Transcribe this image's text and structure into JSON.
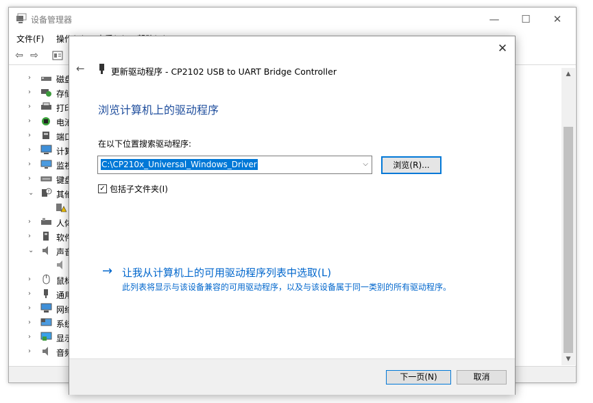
{
  "device_manager": {
    "title": "设备管理器",
    "window_controls": {
      "minimize": "—",
      "maximize": "☐",
      "close": "✕"
    },
    "menu": [
      "文件(F)",
      "操作(A)",
      "查看(V)",
      "帮助(H)"
    ],
    "toolbar_icons": [
      "back-arrow-icon",
      "forward-arrow-icon",
      "properties-icon"
    ],
    "tree": [
      {
        "chevron": "›",
        "label": "磁盘",
        "icon": "disk-drive-icon"
      },
      {
        "chevron": "›",
        "label": "存储",
        "icon": "storage-controller-icon"
      },
      {
        "chevron": "›",
        "label": "打印",
        "icon": "print-queue-icon"
      },
      {
        "chevron": "›",
        "label": "电池",
        "icon": "battery-icon"
      },
      {
        "chevron": "›",
        "label": "端口",
        "icon": "port-icon"
      },
      {
        "chevron": "›",
        "label": "计算",
        "icon": "computer-icon"
      },
      {
        "chevron": "›",
        "label": "监视",
        "icon": "monitor-icon"
      },
      {
        "chevron": "›",
        "label": "键盘",
        "icon": "keyboard-icon"
      },
      {
        "chevron": "⌄",
        "label": "其他",
        "icon": "unknown-device-icon"
      },
      {
        "chevron": "",
        "label": "",
        "icon": "warning-device-icon"
      },
      {
        "chevron": "›",
        "label": "人体",
        "icon": "human-interface-icon"
      },
      {
        "chevron": "›",
        "label": "软件",
        "icon": "software-device-icon"
      },
      {
        "chevron": "⌄",
        "label": "声音",
        "icon": "speaker-icon"
      },
      {
        "chevron": "",
        "label": "",
        "icon": "audio-device-icon"
      },
      {
        "chevron": "›",
        "label": "鼠标",
        "icon": "mouse-icon"
      },
      {
        "chevron": "›",
        "label": "通用",
        "icon": "usb-icon"
      },
      {
        "chevron": "›",
        "label": "网络",
        "icon": "network-icon"
      },
      {
        "chevron": "›",
        "label": "系统",
        "icon": "system-device-icon"
      },
      {
        "chevron": "›",
        "label": "显示",
        "icon": "display-adapter-icon"
      },
      {
        "chevron": "›",
        "label": "音频",
        "icon": "audio-io-icon"
      }
    ]
  },
  "dialog": {
    "back_glyph": "←",
    "close_glyph": "✕",
    "title": "更新驱动程序 - CP2102 USB to UART Bridge Controller",
    "heading": "浏览计算机上的驱动程序",
    "path_label": "在以下位置搜索驱动程序:",
    "path_value": "C:\\CP210x_Universal_Windows_Driver",
    "combo_arrow": "⌵",
    "browse_label": "浏览(R)...",
    "include_subfolders": {
      "label": "包括子文件夹(I)",
      "checked": true,
      "check_glyph": "✓"
    },
    "pick_arrow": "→",
    "pick_link": "让我从计算机上的可用驱动程序列表中选取(L)",
    "pick_desc": "此列表将显示与该设备兼容的可用驱动程序，以及与该设备属于同一类别的所有驱动程序。",
    "next_label": "下一页(N)",
    "cancel_label": "取消"
  },
  "colors": {
    "accent": "#0078d7",
    "link": "#0066cc",
    "heading": "#1f4e9d"
  }
}
